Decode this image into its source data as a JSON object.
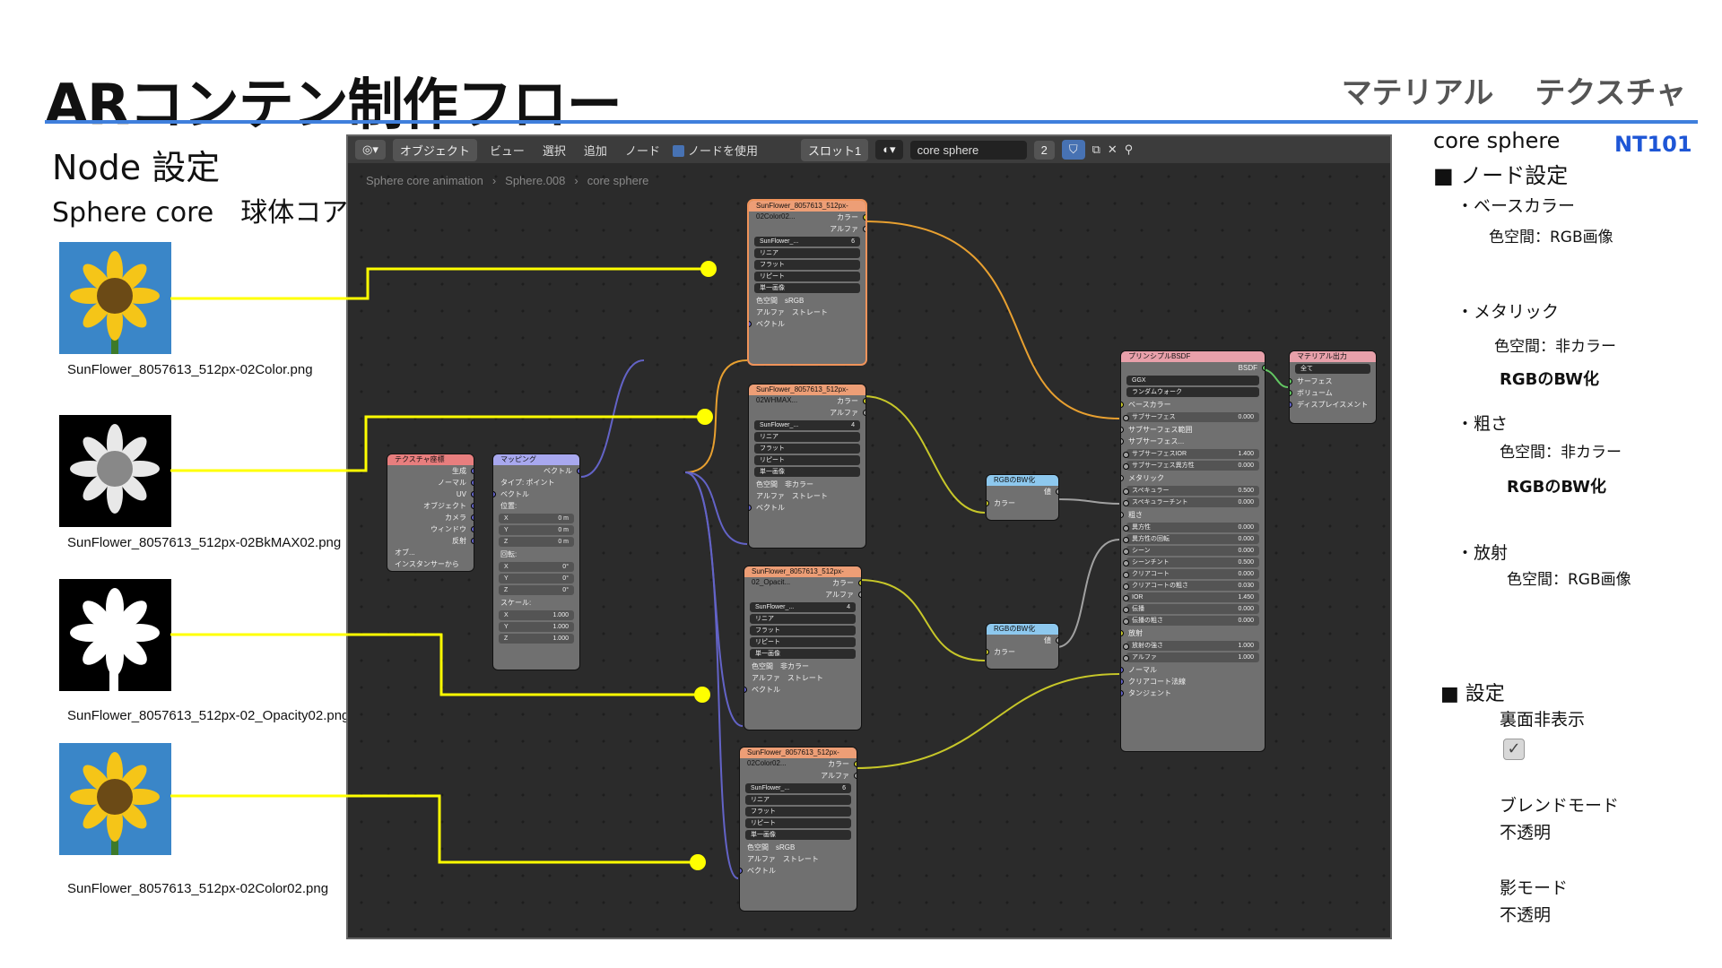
{
  "slide": {
    "title": "ARコンテン制作フロー",
    "top_right": [
      "マテリアル",
      "テクスチャ"
    ],
    "left_heading": "Node 設定",
    "left_sub": "Sphere core　球体コア",
    "thumbnails": [
      {
        "caption": "SunFlower_8057613_512px-02Color.png"
      },
      {
        "caption": "SunFlower_8057613_512px-02BkMAX02.png"
      },
      {
        "caption": "SunFlower_8057613_512px-02_Opacity02.png"
      },
      {
        "caption": "SunFlower_8057613_512px-02Color02.png"
      }
    ],
    "accent_color": "#3f7fdc",
    "connector_color": "#ffff00"
  },
  "blender": {
    "header": {
      "mode": "オブジェクト",
      "menus": [
        "ビュー",
        "選択",
        "追加",
        "ノード"
      ],
      "use_nodes": "ノードを使用",
      "slot": "スロット1",
      "material": "core sphere",
      "users": "2"
    },
    "breadcrumb": [
      "Sphere core animation",
      "Sphere.008",
      "core sphere"
    ],
    "image_nodes": [
      {
        "title": "SunFlower_8057613_512px-02Color02...",
        "img": "SunFlower_...",
        "users": "6",
        "opts": [
          "リニア",
          "フラット",
          "リピート",
          "単一画像"
        ],
        "cs_label": "色空間",
        "cs": "sRGB",
        "alpha_label": "アルファ",
        "alpha": "ストレート",
        "out_color": "カラー",
        "out_alpha": "アルファ",
        "in_vec": "ベクトル"
      },
      {
        "title": "SunFlower_8057613_512px-02WHMAX...",
        "img": "SunFlower_...",
        "users": "4",
        "opts": [
          "リニア",
          "フラット",
          "リピート",
          "単一画像"
        ],
        "cs_label": "色空間",
        "cs": "非カラー",
        "alpha_label": "アルファ",
        "alpha": "ストレート",
        "out_color": "カラー",
        "out_alpha": "アルファ",
        "in_vec": "ベクトル"
      },
      {
        "title": "SunFlower_8057613_512px-02_Opacit...",
        "img": "SunFlower_...",
        "users": "4",
        "opts": [
          "リニア",
          "フラット",
          "リピート",
          "単一画像"
        ],
        "cs_label": "色空間",
        "cs": "非カラー",
        "alpha_label": "アルファ",
        "alpha": "ストレート",
        "out_color": "カラー",
        "out_alpha": "アルファ",
        "in_vec": "ベクトル"
      },
      {
        "title": "SunFlower_8057613_512px-02Color02...",
        "img": "SunFlower_...",
        "users": "6",
        "opts": [
          "リニア",
          "フラット",
          "リピート",
          "単一画像"
        ],
        "cs_label": "色空間",
        "cs": "sRGB",
        "alpha_label": "アルファ",
        "alpha": "ストレート",
        "out_color": "カラー",
        "out_alpha": "アルファ",
        "in_vec": "ベクトル"
      }
    ],
    "texcoord": {
      "title": "テクスチャ座標",
      "outputs": [
        "生成",
        "ノーマル",
        "UV",
        "オブジェクト",
        "カメラ",
        "ウィンドウ",
        "反射"
      ],
      "obj": "オブ...",
      "instancer": "インスタンサーから"
    },
    "mapping": {
      "title": "マッピング",
      "out": "ベクトル",
      "type_label": "タイプ:",
      "type": "ポイント",
      "in_vec": "ベクトル",
      "loc_label": "位置:",
      "loc": [
        [
          "X",
          "0 m"
        ],
        [
          "Y",
          "0 m"
        ],
        [
          "Z",
          "0 m"
        ]
      ],
      "rot_label": "回転:",
      "rot": [
        [
          "X",
          "0°"
        ],
        [
          "Y",
          "0°"
        ],
        [
          "Z",
          "0°"
        ]
      ],
      "scale_label": "スケール:",
      "scale": [
        [
          "X",
          "1.000"
        ],
        [
          "Y",
          "1.000"
        ],
        [
          "Z",
          "1.000"
        ]
      ]
    },
    "bw_nodes": [
      {
        "title": "RGBのBW化",
        "out": "値",
        "in": "カラー"
      },
      {
        "title": "RGBのBW化",
        "out": "値",
        "in": "カラー"
      }
    ],
    "bsdf": {
      "title": "プリンシプルBSDF",
      "out": "BSDF",
      "dist": "GGX",
      "sss_method": "ランダムウォーク",
      "rows": [
        [
          "ベースカラー",
          ""
        ],
        [
          "サブサーフェス",
          "0.000"
        ],
        [
          "サブサーフェス範囲",
          ""
        ],
        [
          "サブサーフェス...",
          ""
        ],
        [
          "サブサーフェスIOR",
          "1.400"
        ],
        [
          "サブサーフェス異方性",
          "0.000"
        ],
        [
          "メタリック",
          ""
        ],
        [
          "スペキュラー",
          "0.500"
        ],
        [
          "スペキュラーチント",
          "0.000"
        ],
        [
          "粗さ",
          ""
        ],
        [
          "異方性",
          "0.000"
        ],
        [
          "異方性の回転",
          "0.000"
        ],
        [
          "シーン",
          "0.000"
        ],
        [
          "シーンチント",
          "0.500"
        ],
        [
          "クリアコート",
          "0.000"
        ],
        [
          "クリアコートの粗さ",
          "0.030"
        ],
        [
          "IOR",
          "1.450"
        ],
        [
          "伝播",
          "0.000"
        ],
        [
          "伝播の粗さ",
          "0.000"
        ],
        [
          "放射",
          ""
        ],
        [
          "放射の強さ",
          "1.000"
        ],
        [
          "アルファ",
          "1.000"
        ],
        [
          "ノーマル",
          ""
        ],
        [
          "クリアコート法線",
          ""
        ],
        [
          "タンジェント",
          ""
        ]
      ]
    },
    "output": {
      "title": "マテリアル出力",
      "target": "全て",
      "inputs": [
        "サーフェス",
        "ボリューム",
        "ディスプレイスメント"
      ]
    }
  },
  "notes": {
    "name": "core sphere",
    "code": "NT101",
    "node_heading": "■ ノード設定",
    "base": "・ベースカラー",
    "base_cs": "色空間：RGB画像",
    "metal": "・メタリック",
    "metal_cs": "色空間：非カラー",
    "metal_bw": "RGBのBW化",
    "rough": "・粗さ",
    "rough_cs": "色空間：非カラー",
    "rough_bw": "RGBのBW化",
    "emit": "・放射",
    "emit_cs": "色空間：RGB画像",
    "settings_heading": "■ 設定",
    "backface": "裏面非表示",
    "blend_label": "ブレンドモード",
    "blend_value": "不透明",
    "shadow_label": "影モード",
    "shadow_value": "不透明"
  }
}
